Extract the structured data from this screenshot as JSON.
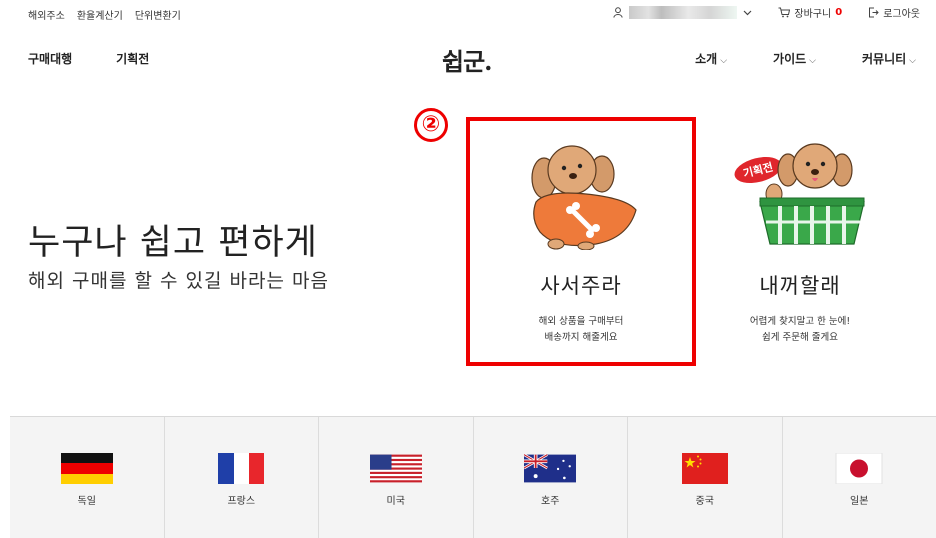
{
  "utility_bar": {
    "links": [
      "해외주소",
      "환율계산기",
      "단위변환기"
    ],
    "cart_label": "장바구니",
    "cart_count": "0",
    "logout_label": "로그아웃"
  },
  "nav": {
    "left": [
      "구매대행",
      "기획전"
    ],
    "logo": "쉽군.",
    "right": [
      "소개",
      "가이드",
      "커뮤니티"
    ]
  },
  "hero": {
    "title": "누구나 쉽고 편하게",
    "subtitle": "해외 구매를 할 수 있길 바라는 마음"
  },
  "annotation": {
    "label": "②"
  },
  "cards": [
    {
      "title": "사서주라",
      "desc_line1": "해외 상품을 구매부터",
      "desc_line2": "배송까지 해줄게요",
      "badge": ""
    },
    {
      "title": "내꺼할래",
      "desc_line1": "어렵게 찾지말고 한 눈에!",
      "desc_line2": "쉽게 주문해 줄게요",
      "badge": "기획전"
    }
  ],
  "countries": [
    {
      "name": "독일",
      "flag": "germany"
    },
    {
      "name": "프랑스",
      "flag": "france"
    },
    {
      "name": "미국",
      "flag": "usa"
    },
    {
      "name": "호주",
      "flag": "australia"
    },
    {
      "name": "중국",
      "flag": "china"
    },
    {
      "name": "일본",
      "flag": "japan"
    }
  ],
  "colors": {
    "accent_red": "#ee0000",
    "strip_bg": "#f4f4f4"
  }
}
